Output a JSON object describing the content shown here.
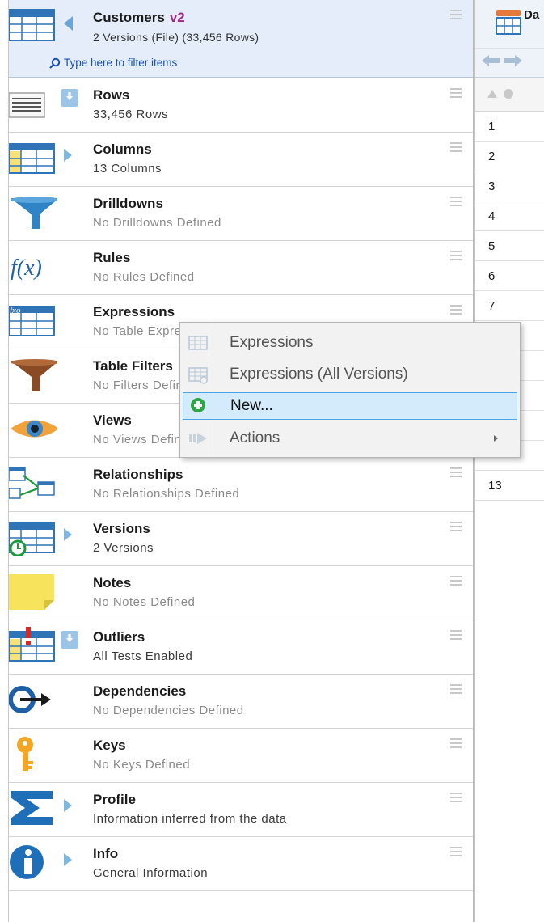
{
  "header": {
    "title": "Customers",
    "version": "v2",
    "subtitle": "2 Versions (File)  (33,456 Rows)",
    "filter_placeholder": "Type here to filter items"
  },
  "items": [
    {
      "title": "Rows",
      "subtitle": "33,456 Rows",
      "icon": "rows-icon"
    },
    {
      "title": "Columns",
      "subtitle": "13 Columns",
      "icon": "columns-icon"
    },
    {
      "title": "Drilldowns",
      "subtitle": "No Drilldowns Defined",
      "icon": "funnel-icon"
    },
    {
      "title": "Rules",
      "subtitle": "No Rules Defined",
      "icon": "function-icon"
    },
    {
      "title": "Expressions",
      "subtitle": "No Table Expressions Defined",
      "icon": "expressions-table-icon"
    },
    {
      "title": "Table Filters",
      "subtitle": "No Filters Defined",
      "icon": "table-filter-icon"
    },
    {
      "title": "Views",
      "subtitle": "No Views Defined",
      "icon": "eye-icon"
    },
    {
      "title": "Relationships",
      "subtitle": "No Relationships Defined",
      "icon": "relationships-icon"
    },
    {
      "title": "Versions",
      "subtitle": "2 Versions",
      "icon": "versions-icon"
    },
    {
      "title": "Notes",
      "subtitle": "No Notes Defined",
      "icon": "note-icon"
    },
    {
      "title": "Outliers",
      "subtitle": "All Tests Enabled",
      "icon": "outliers-icon"
    },
    {
      "title": "Dependencies",
      "subtitle": "No Dependencies Defined",
      "icon": "dependencies-icon"
    },
    {
      "title": "Keys",
      "subtitle": "No Keys Defined",
      "icon": "key-icon"
    },
    {
      "title": "Profile",
      "subtitle": "Information inferred from the data",
      "icon": "sigma-icon"
    },
    {
      "title": "Info",
      "subtitle": "General Information",
      "icon": "info-icon"
    }
  ],
  "context_menu": {
    "items": [
      {
        "label": "Expressions"
      },
      {
        "label": "Expressions (All Versions)"
      },
      {
        "label": "New..."
      },
      {
        "label": "Actions"
      }
    ]
  },
  "data_pane": {
    "title": "Da",
    "row_numbers": [
      "1",
      "2",
      "3",
      "4",
      "5",
      "6",
      "7",
      "",
      "",
      "",
      "",
      "",
      "13"
    ]
  },
  "colors": {
    "header_bg": "#e4edf9",
    "version_color": "#9b2a86",
    "filter_link": "#1a4fb0",
    "menu_highlight": "#d4ebfb",
    "menu_highlight_border": "#4ea3e4"
  }
}
